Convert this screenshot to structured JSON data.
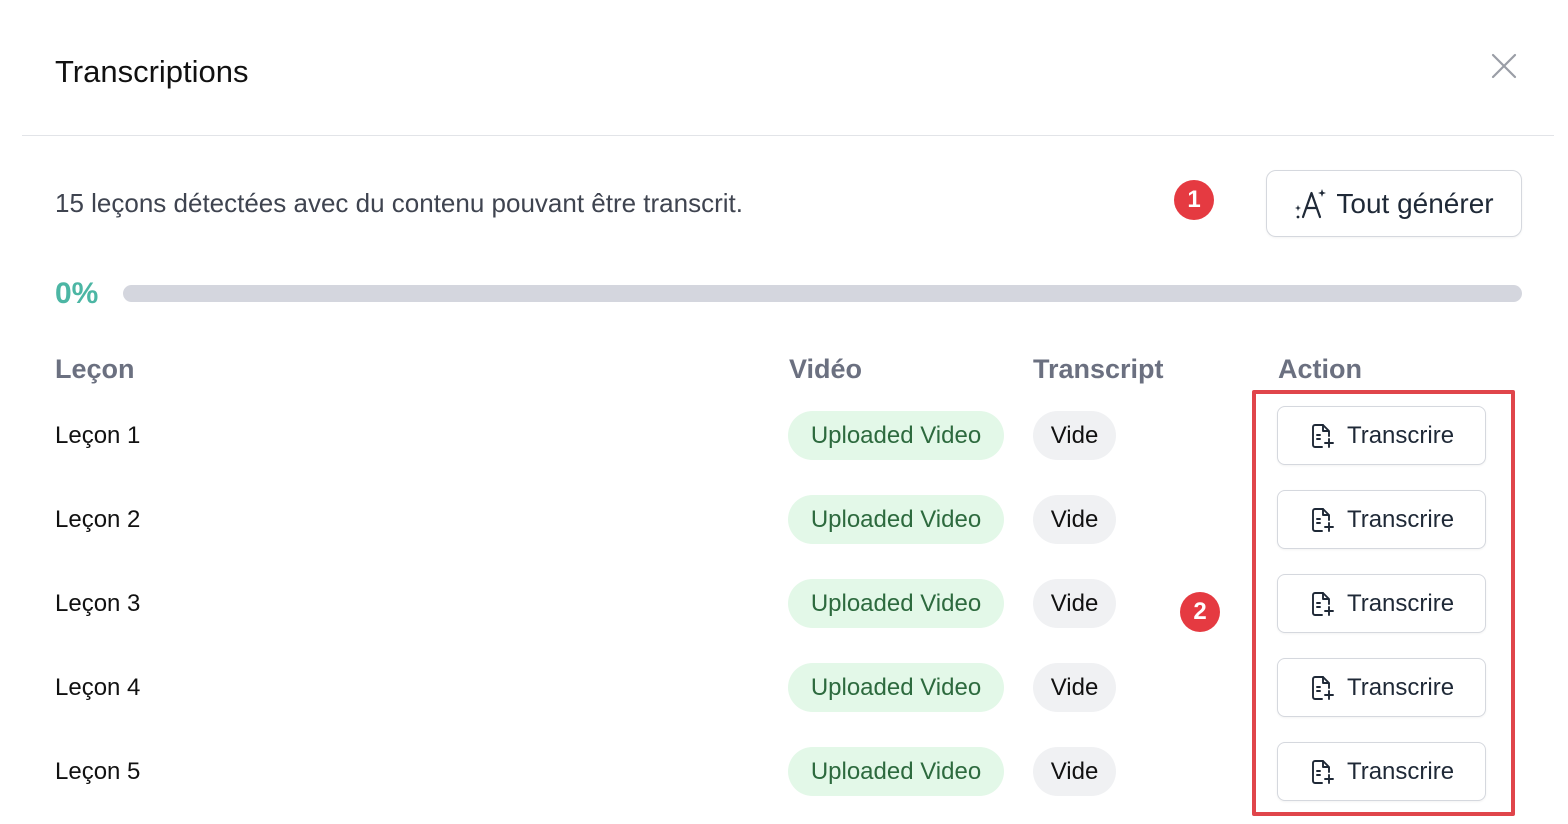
{
  "dialog": {
    "title": "Transcriptions"
  },
  "summary": {
    "text": "15 leçons détectées avec du contenu pouvant être transcrit."
  },
  "generate_all": {
    "label": "Tout générer",
    "icon": "sparkle-text-icon"
  },
  "progress": {
    "label": "0%",
    "value": 0
  },
  "table": {
    "headers": {
      "lesson": "Leçon",
      "video": "Vidéo",
      "transcript": "Transcript",
      "action": "Action"
    },
    "rows": [
      {
        "lesson": "Leçon 1",
        "video": "Uploaded Video",
        "transcript": "Vide",
        "action": "Transcrire"
      },
      {
        "lesson": "Leçon 2",
        "video": "Uploaded Video",
        "transcript": "Vide",
        "action": "Transcrire"
      },
      {
        "lesson": "Leçon 3",
        "video": "Uploaded Video",
        "transcript": "Vide",
        "action": "Transcrire"
      },
      {
        "lesson": "Leçon 4",
        "video": "Uploaded Video",
        "transcript": "Vide",
        "action": "Transcrire"
      },
      {
        "lesson": "Leçon 5",
        "video": "Uploaded Video",
        "transcript": "Vide",
        "action": "Transcrire"
      }
    ]
  },
  "annotations": {
    "badge_1": "1",
    "badge_2": "2"
  },
  "colors": {
    "accent": "#4cb6a4",
    "annotation_red": "#e53a41",
    "video_pill_bg": "#e3f8e8",
    "video_pill_text": "#2d6a3e",
    "empty_pill_bg": "#f0f1f3",
    "progress_track": "#d4d6de"
  },
  "icons": {
    "close": "close-icon",
    "transcribe": "file-plus-icon"
  }
}
